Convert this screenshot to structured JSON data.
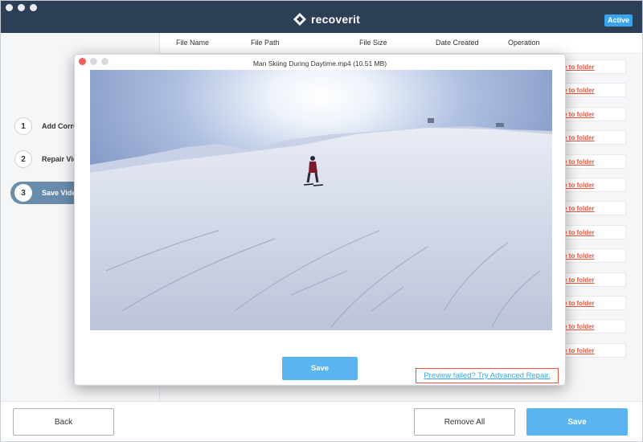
{
  "app": {
    "logo_text": "recoverit",
    "status_badge": "Active",
    "colors": {
      "titlebar": "#2d3e57",
      "accent": "#5ab4f0",
      "link_orange": "#e8583f",
      "link_blue": "#3aa4ea"
    }
  },
  "sidebar": {
    "steps": [
      {
        "num": "1",
        "label": "Add Corru"
      },
      {
        "num": "2",
        "label": "Repair Vid"
      },
      {
        "num": "3",
        "label": "Save Vide"
      }
    ]
  },
  "table": {
    "headers": [
      "File Name",
      "File Path",
      "File Size",
      "Date Created",
      "Operation"
    ],
    "op_link_text": "e to folder",
    "row_count": 13
  },
  "modal": {
    "title": "Man Skiing During Daytime.mp4 (10.51 MB)",
    "save_label": "Save",
    "advanced_link": "Preview failed? Try Advanced Repair."
  },
  "footer": {
    "back_label": "Back",
    "remove_all_label": "Remove All",
    "save_label": "Save"
  }
}
